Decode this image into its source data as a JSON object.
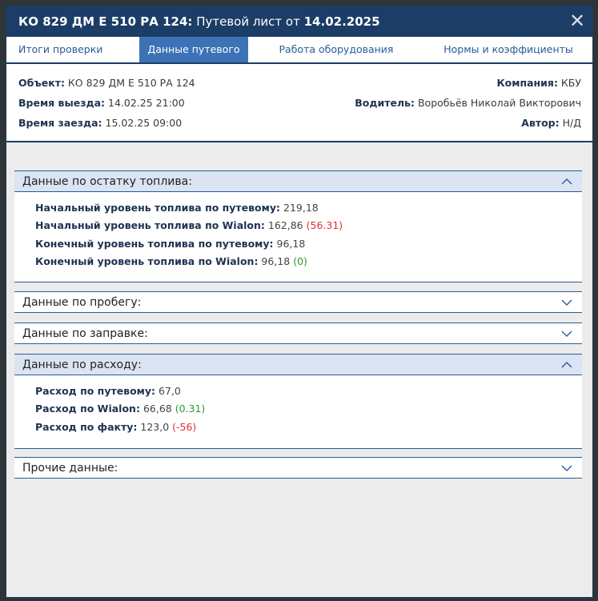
{
  "window": {
    "title_bold": "КО 829 ДМ Е 510 РА 124:",
    "title_mid": " Путевой лист от ",
    "title_date": "14.02.2025"
  },
  "icons": {
    "close": "close-icon",
    "expand": "chevron-down-icon",
    "collapse": "chevron-up-icon"
  },
  "tabs": [
    {
      "label": "Итоги проверки",
      "active": false
    },
    {
      "label": "Данные путевого",
      "active": true
    },
    {
      "label": "Работа оборудования",
      "active": false
    },
    {
      "label": "Нормы и коэффициенты",
      "active": false
    }
  ],
  "info": {
    "object_label": "Объект:",
    "object_value": " КО 829 ДМ Е 510 РА 124",
    "departure_label": "Время выезда:",
    "departure_value": " 14.02.25 21:00",
    "arrival_label": "Время заезда:",
    "arrival_value": " 15.02.25 09:00",
    "company_label": "Компания:",
    "company_value": " КБУ",
    "driver_label": "Водитель:",
    "driver_value": " Воробьёв Николай Викторович",
    "author_label": "Автор:",
    "author_value": " Н/Д"
  },
  "sections": {
    "fuel": {
      "title": "Данные по остатку топлива:",
      "rows": [
        {
          "label": "Начальный уровень топлива по путевому:",
          "value": " 219,18",
          "delta": ""
        },
        {
          "label": "Начальный уровень топлива по Wialon:",
          "value": " 162,86 ",
          "delta": "(56.31)"
        },
        {
          "label": "Конечный уровень топлива по путевому:",
          "value": " 96,18",
          "delta": ""
        },
        {
          "label": "Конечный уровень топлива по Wialon:",
          "value": " 96,18 ",
          "delta": "(0)"
        }
      ]
    },
    "mileage": {
      "title": "Данные по пробегу:"
    },
    "refuel": {
      "title": "Данные по заправке:"
    },
    "consumption": {
      "title": "Данные по расходу:",
      "rows": [
        {
          "label": "Расход по путевому:",
          "value": " 67,0",
          "delta": ""
        },
        {
          "label": "Расход по Wialon:",
          "value": " 66,68 ",
          "delta": "(0.31)"
        },
        {
          "label": "Расход по факту:",
          "value": " 123,0 ",
          "delta": "(-56)"
        }
      ]
    },
    "other": {
      "title": "Прочие данные:"
    }
  },
  "colors": {
    "header": "#1b3d66",
    "active_tab": "#3b73b6",
    "negative": "#e03030",
    "positive": "#2e9a2e"
  }
}
